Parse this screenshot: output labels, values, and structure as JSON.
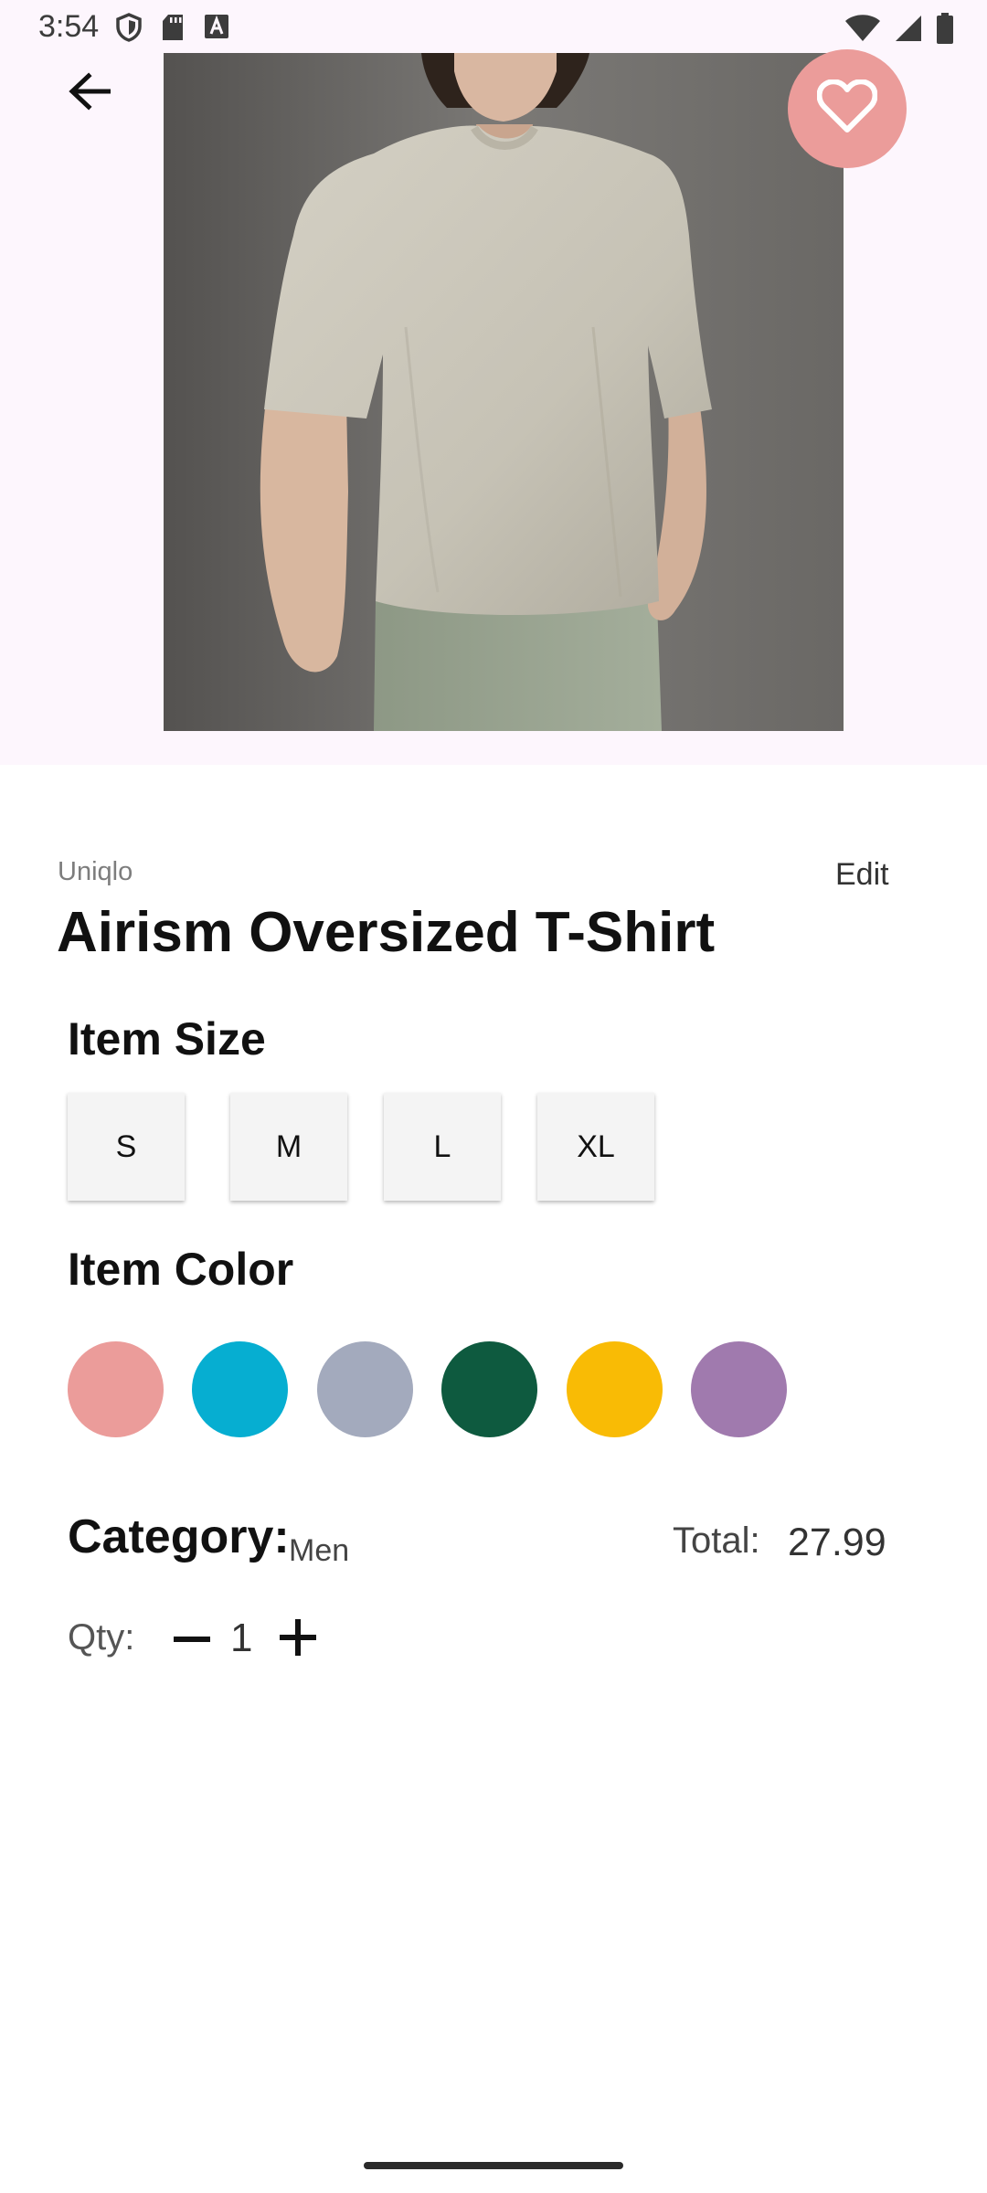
{
  "status_bar": {
    "time": "3:54",
    "icons_left": [
      "shield-icon",
      "sd-card-icon",
      "keyboard-icon"
    ],
    "icons_right": [
      "wifi-icon",
      "signal-icon",
      "battery-icon"
    ]
  },
  "hero": {
    "background": "#fdf6fd",
    "image": "product-photo",
    "back_icon": "arrow-back-icon",
    "favorite_icon": "heart-outline-icon",
    "favorite_color": "#eb9c9a"
  },
  "product": {
    "brand": "Uniqlo",
    "edit_label": "Edit",
    "title": "Airism Oversized T-Shirt"
  },
  "sizes": {
    "heading": "Item Size",
    "options": [
      "S",
      "M",
      "L",
      "XL"
    ]
  },
  "colors": {
    "heading": "Item Color",
    "swatches": [
      "#eb9c9a",
      "#06aed1",
      "#a3aabd",
      "#0e5a3f",
      "#f9bb05",
      "#a07aae"
    ]
  },
  "category": {
    "label": "Category:",
    "value": "Men"
  },
  "total": {
    "label": "Total:",
    "value": "27.99"
  },
  "quantity": {
    "label": "Qty:",
    "value": "1",
    "decrease_icon": "minus-icon",
    "increase_icon": "plus-icon"
  }
}
